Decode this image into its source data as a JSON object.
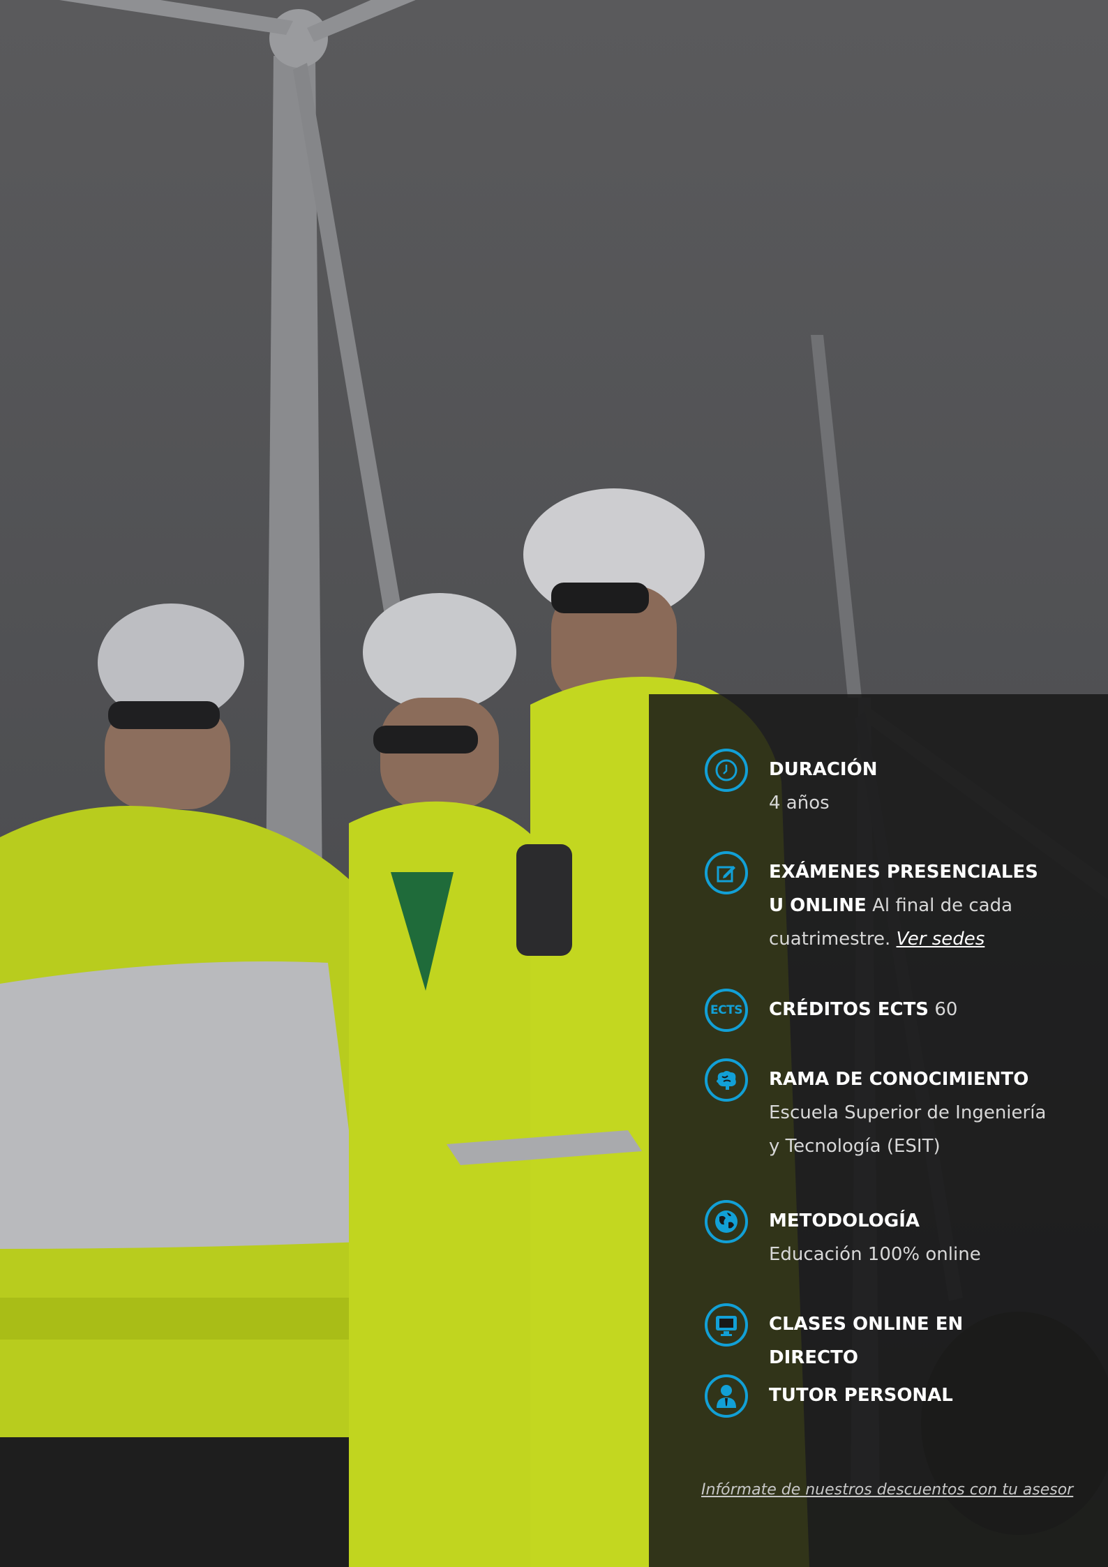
{
  "features": [
    {
      "icon": "clock-icon",
      "title": "DURACIÓN",
      "value": "4 años"
    },
    {
      "icon": "pen-square-icon",
      "title": "EXÁMENES PRESENCIALES U ONLINE",
      "value": "Al final de cada cuatrimestre.",
      "link": "Ver sedes"
    },
    {
      "icon": "ects-badge-icon",
      "icon_text": "ECTS",
      "title": "CRÉDITOS ECTS",
      "value": "60"
    },
    {
      "icon": "brain-icon",
      "title": "RAMA DE CONOCIMIENTO",
      "value": "Escuela Superior de Ingeniería y Tecnología (ESIT)"
    },
    {
      "icon": "globe-icon",
      "title": "METODOLOGÍA",
      "value": "Educación 100% online"
    },
    {
      "icon": "monitor-icon",
      "title": "CLASES ONLINE EN DIRECTO"
    },
    {
      "icon": "tutor-person-icon",
      "title": "TUTOR PERSONAL"
    }
  ],
  "footer_link": "Infórmate de nuestros descuentos con tu asesor",
  "colors": {
    "accent": "#12a0d6",
    "panel": "#181818",
    "hivis": "#c6dd1c",
    "harness": "#1f6b3a"
  }
}
